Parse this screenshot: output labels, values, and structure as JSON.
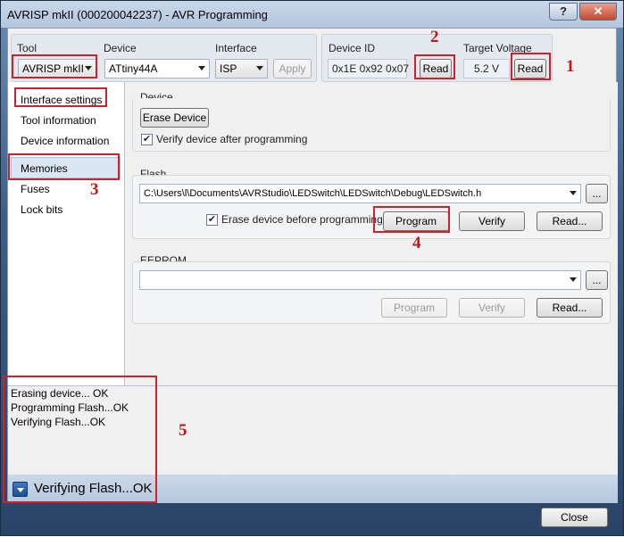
{
  "window": {
    "title": "AVRISP mkII (000200042237) - AVR Programming",
    "help_btn": "?",
    "min_btn": "−",
    "close_btn": "✕"
  },
  "toolbar": {
    "tool_label": "Tool",
    "tool_value": "AVRISP mkII",
    "device_label": "Device",
    "device_value": "ATtiny44A",
    "interface_label": "Interface",
    "interface_value": "ISP",
    "apply_label": "Apply",
    "device_id_label": "Device ID",
    "device_id_value": "0x1E 0x92 0x07",
    "read_id_label": "Read",
    "target_voltage_label": "Target Voltage",
    "target_voltage_value": "5.2 V",
    "read_voltage_label": "Read"
  },
  "sidebar": {
    "items": [
      {
        "label": "Interface settings"
      },
      {
        "label": "Tool information"
      },
      {
        "label": "Device information"
      },
      {
        "label": "Memories"
      },
      {
        "label": "Fuses"
      },
      {
        "label": "Lock bits"
      }
    ],
    "selected": "Memories"
  },
  "device_section": {
    "title": "Device",
    "erase_label": "Erase Device",
    "verify_label": "Verify device after programming",
    "verify_checked": true
  },
  "flash_section": {
    "title": "Flash",
    "path": "C:\\Users\\l\\Documents\\AVRStudio\\LEDSwitch\\LEDSwitch\\Debug\\LEDSwitch.h",
    "browse_label": "...",
    "erase_before_label": "Erase device before programming",
    "erase_before_checked": true,
    "program_label": "Program",
    "verify_label": "Verify",
    "read_label": "Read..."
  },
  "eeprom_section": {
    "title": "EEPROM",
    "path": "",
    "browse_label": "...",
    "program_label": "Program",
    "verify_label": "Verify",
    "read_label": "Read..."
  },
  "log": {
    "lines": [
      "Erasing device... OK",
      "Programming Flash...OK",
      "Verifying Flash...OK"
    ]
  },
  "status": {
    "text": "Verifying Flash...OK"
  },
  "footer": {
    "close_label": "Close"
  },
  "annotations": {
    "n1": "1",
    "n2": "2",
    "n3": "3",
    "n4": "4",
    "n5": "5"
  },
  "colors": {
    "annotation_red": "#d0202a",
    "frame_blue": "#3f5f86"
  }
}
